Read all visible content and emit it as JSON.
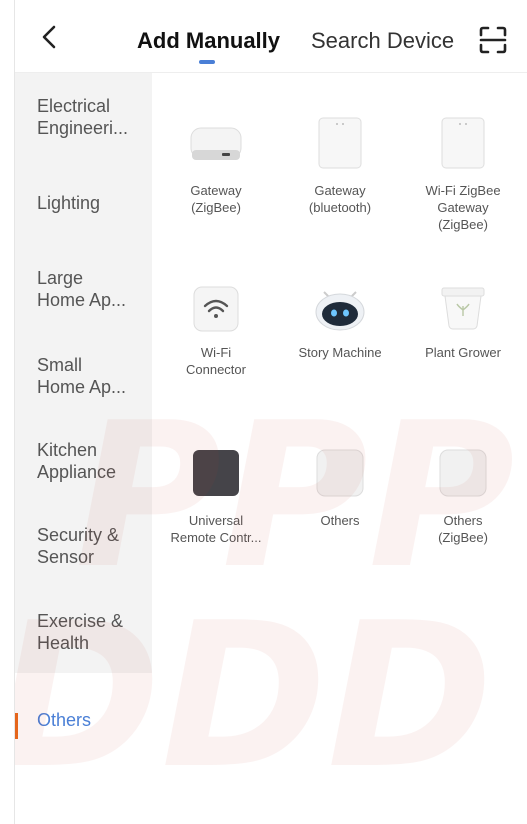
{
  "header": {
    "tab_active": "Add Manually",
    "tab_inactive": "Search Device",
    "back_icon": "chevron-left-icon",
    "scan_icon": "scan-icon"
  },
  "colors": {
    "accent": "#4a7fd6",
    "active_indicator": "#e8681a",
    "sidebar_bg": "#f3f3f3"
  },
  "sidebar": {
    "items": [
      {
        "label": "Electrical\nEngineeri..."
      },
      {
        "label": "Lighting"
      },
      {
        "label": "Large\nHome Ap..."
      },
      {
        "label": "Small\nHome Ap..."
      },
      {
        "label": "Kitchen\nAppliance"
      },
      {
        "label": "Security &\nSensor"
      },
      {
        "label": "Exercise &\nHealth"
      },
      {
        "label": "Others"
      }
    ],
    "selected": "Others"
  },
  "devices": [
    {
      "label": "Gateway\n(ZigBee)",
      "icon": "gateway-zigbee-icon"
    },
    {
      "label": "Gateway\n(bluetooth)",
      "icon": "gateway-bluetooth-icon"
    },
    {
      "label": "Wi-Fi ZigBee\nGateway\n(ZigBee)",
      "icon": "wifi-zigbee-gateway-icon"
    },
    {
      "label": "Wi-Fi\nConnector",
      "icon": "wifi-connector-icon"
    },
    {
      "label": "Story Machine",
      "icon": "story-machine-icon"
    },
    {
      "label": "Plant Grower",
      "icon": "plant-grower-icon"
    },
    {
      "label": "Universal\nRemote Contr...",
      "icon": "universal-remote-icon"
    },
    {
      "label": "Others",
      "icon": "others-device-icon"
    },
    {
      "label": "Others\n(ZigBee)",
      "icon": "others-zigbee-icon"
    }
  ]
}
